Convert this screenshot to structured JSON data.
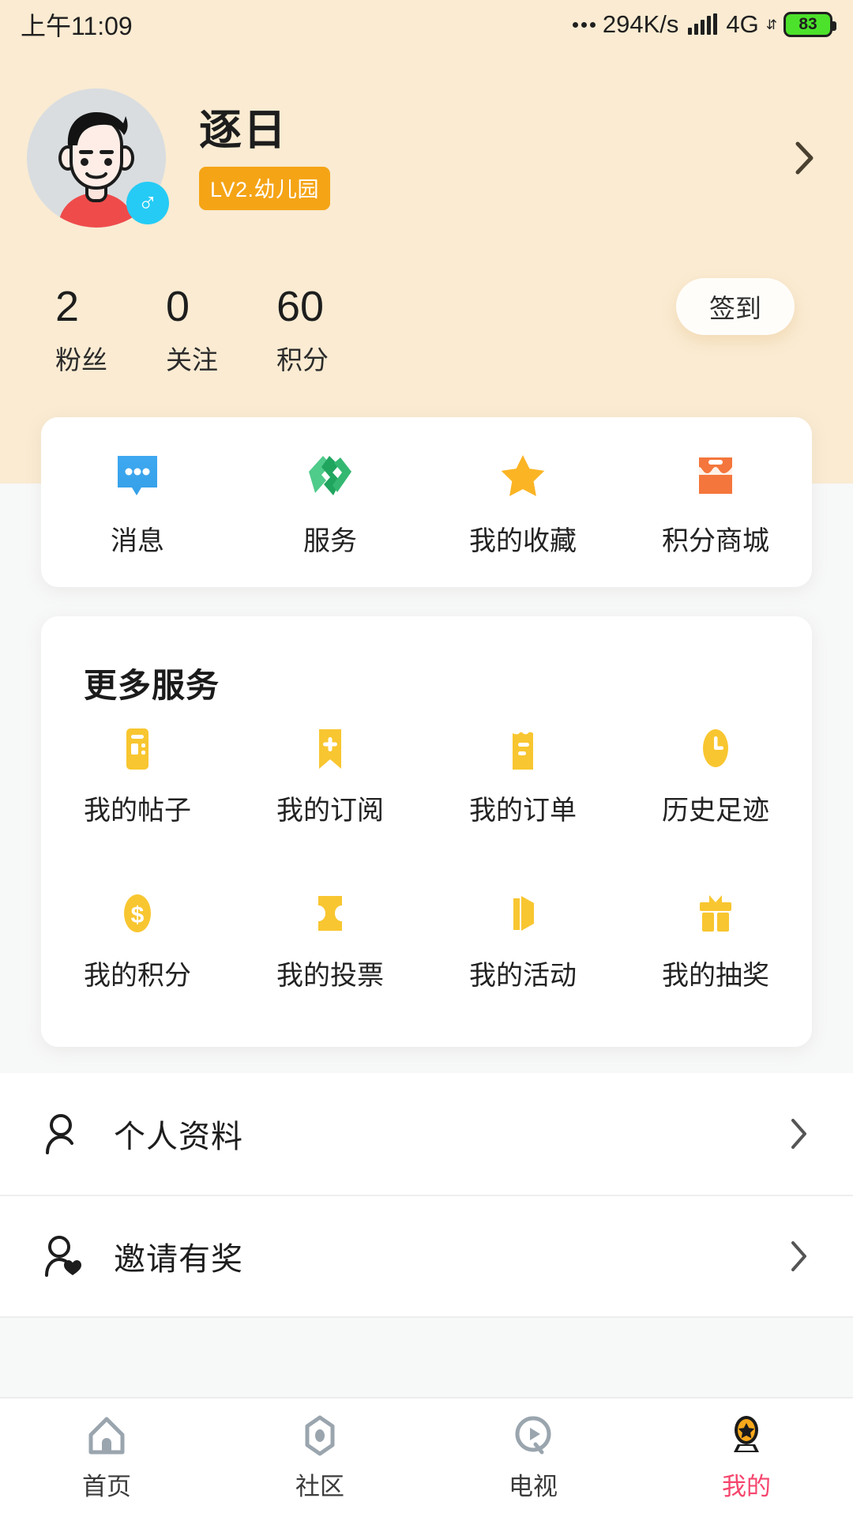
{
  "status_bar": {
    "time": "上午11:09",
    "net_speed": "294K/s",
    "network_type": "4G",
    "battery_level": "83"
  },
  "profile": {
    "nickname": "逐日",
    "level_badge": "LV2.幼儿园",
    "gender_symbol": "♂",
    "arrow": "chevron-right"
  },
  "stats": {
    "items": [
      {
        "value": "2",
        "label": "粉丝"
      },
      {
        "value": "0",
        "label": "关注"
      },
      {
        "value": "60",
        "label": "积分"
      }
    ],
    "signin_label": "签到"
  },
  "quick_actions": [
    {
      "label": "消息",
      "icon": "message-icon",
      "color": "#2E9BE8"
    },
    {
      "label": "服务",
      "icon": "handshake-icon",
      "color": "#2FBF71"
    },
    {
      "label": "我的收藏",
      "icon": "star-icon",
      "color": "#FBB424"
    },
    {
      "label": "积分商城",
      "icon": "shop-icon",
      "color": "#F4763C"
    }
  ],
  "services": {
    "title": "更多服务",
    "rows": [
      [
        {
          "label": "我的帖子",
          "icon": "posts-icon"
        },
        {
          "label": "我的订阅",
          "icon": "bookmark-plus-icon"
        },
        {
          "label": "我的订单",
          "icon": "order-icon"
        },
        {
          "label": "历史足迹",
          "icon": "clock-icon"
        }
      ],
      [
        {
          "label": "我的积分",
          "icon": "coin-icon"
        },
        {
          "label": "我的投票",
          "icon": "ticket-icon"
        },
        {
          "label": "我的活动",
          "icon": "megaphone-icon"
        },
        {
          "label": "我的抽奖",
          "icon": "gift-icon"
        }
      ]
    ],
    "icon_color": "#F8C630"
  },
  "list_rows": [
    {
      "label": "个人资料",
      "icon": "person-icon"
    },
    {
      "label": "邀请有奖",
      "icon": "person-heart-icon"
    }
  ],
  "bottom_nav": {
    "items": [
      {
        "label": "首页",
        "icon": "home-icon",
        "active": false
      },
      {
        "label": "社区",
        "icon": "community-icon",
        "active": false
      },
      {
        "label": "电视",
        "icon": "tv-play-icon",
        "active": false
      },
      {
        "label": "我的",
        "icon": "profile-trophy-icon",
        "active": true
      }
    ],
    "active_color": "#F5466E"
  }
}
